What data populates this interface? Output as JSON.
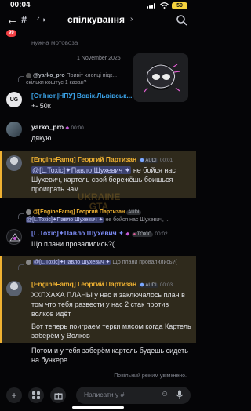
{
  "status_bar": {
    "time": "00:04",
    "battery": "59"
  },
  "header": {
    "back_badge": "99",
    "channel_name": "спілкування",
    "chevron": "›"
  },
  "faded_top_text": "нужна мотовоза",
  "divider": "1 November 2025",
  "messages": [
    {
      "reply_preview": {
        "author": "@yarko_pro",
        "text": "Привіт хлопці підк... скільки коштує 1 казан?"
      },
      "author": "[Ст.Інст.|НПУ] Вовік.Львівськ...",
      "time": "",
      "text": "+- 50к",
      "avatar_letters": "UG",
      "color": "#3ba3e8"
    },
    {
      "author": "yarko_pro",
      "time": "00:00",
      "text": "дякую",
      "color": "#e3e4e8"
    },
    {
      "author": "[EngineFamq] Георгий Партизан",
      "author_tag": "AUDI",
      "time": "00:01",
      "mention": "@[L.Toxic]✦Павло Шухевич ✦",
      "text": "не бойся нас Шухевич, картель свой бережёшь боишься проиграть нам",
      "color": "#f0b232"
    },
    {
      "reply_preview": {
        "author": "@[EngineFamq] Георгий Партизан",
        "tag": "AUDI",
        "mention": "@[L.Toxic]✦Павло Шухевич ✦",
        "text": "не бойся нас Шухевич, ..."
      },
      "author": "[L.Toxic]✦Павло Шухевич ✦",
      "author_tag": "TOXIC",
      "time": "00:02",
      "text": "Що плани провалились?(",
      "color": "#7d8cf5"
    },
    {
      "reply_preview": {
        "author": "@[L.Toxic]✦Павло Шухевич ✦",
        "text": "Що плани провалились?("
      },
      "author": "[EngineFamq] Георгий Партизан",
      "author_tag": "AUDI",
      "time": "00:03",
      "text": "ХХПХАХА ПЛАНЫ у нас и заключалось план в том что тебя развести у нас 2 стак против волков идёт",
      "color": "#f0b232"
    }
  ],
  "followups": [
    "Вот теперь поиграем терки мясом когда Картель заберём у Волков",
    "Потом и у тебя заберём картель будешь сидеть на бункере"
  ],
  "notice": "Повільний режим увімкнено.",
  "input": {
    "placeholder": "Написати у #"
  },
  "watermark": "UKRAINE GTA"
}
